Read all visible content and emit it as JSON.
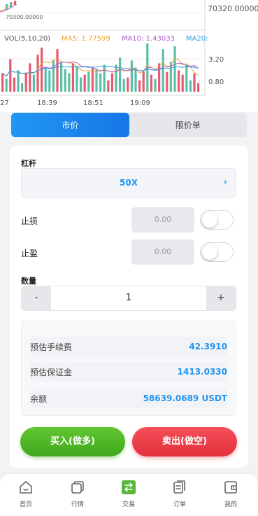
{
  "chart": {
    "price_top_right": "70320.00000",
    "price_left_label": "70300.00000",
    "vol_label": "VOL(5,10,20)",
    "ma5_label": "MA5: 1.77599",
    "ma10_label": "MA10: 1.43033",
    "ma20_label": "MA20:",
    "vol_tick_high": "3.20",
    "vol_tick_low": "0.80",
    "times": [
      "27",
      "18:39",
      "18:51",
      "19:09"
    ],
    "colors": {
      "up": "#5bbfa8",
      "down": "#e65c6e",
      "ma5": "#f0a030",
      "ma10": "#b45ac8",
      "ma20": "#2d9be0"
    },
    "volumes": [
      {
        "v": 1.3,
        "up": false
      },
      {
        "v": 0.9,
        "up": true
      },
      {
        "v": 2.3,
        "up": false
      },
      {
        "v": 1.0,
        "up": false
      },
      {
        "v": 1.5,
        "up": true
      },
      {
        "v": 0.6,
        "up": true
      },
      {
        "v": 1.3,
        "up": false
      },
      {
        "v": 2.0,
        "up": false
      },
      {
        "v": 1.2,
        "up": true
      },
      {
        "v": 2.6,
        "up": false
      },
      {
        "v": 3.1,
        "up": false
      },
      {
        "v": 1.7,
        "up": true
      },
      {
        "v": 1.5,
        "up": true
      },
      {
        "v": 2.2,
        "up": true
      },
      {
        "v": 3.0,
        "up": false
      },
      {
        "v": 2.1,
        "up": true
      },
      {
        "v": 1.6,
        "up": true
      },
      {
        "v": 1.3,
        "up": true
      },
      {
        "v": 2.0,
        "up": false
      },
      {
        "v": 1.8,
        "up": true
      },
      {
        "v": 1.0,
        "up": true
      },
      {
        "v": 1.2,
        "up": false
      },
      {
        "v": 1.4,
        "up": true
      },
      {
        "v": 1.7,
        "up": false
      },
      {
        "v": 1.6,
        "up": true
      },
      {
        "v": 1.3,
        "up": true
      },
      {
        "v": 1.9,
        "up": true
      },
      {
        "v": 0.8,
        "up": false
      },
      {
        "v": 1.3,
        "up": false
      },
      {
        "v": 1.9,
        "up": true
      },
      {
        "v": 2.4,
        "up": true
      },
      {
        "v": 0.9,
        "up": true
      },
      {
        "v": 1.0,
        "up": false
      },
      {
        "v": 2.2,
        "up": true
      },
      {
        "v": 1.7,
        "up": true
      },
      {
        "v": 0.8,
        "up": false
      },
      {
        "v": 1.4,
        "up": false
      },
      {
        "v": 3.4,
        "up": true
      },
      {
        "v": 1.2,
        "up": false
      },
      {
        "v": 0.9,
        "up": true
      },
      {
        "v": 2.0,
        "up": false
      },
      {
        "v": 3.0,
        "up": true
      },
      {
        "v": 1.4,
        "up": false
      },
      {
        "v": 2.1,
        "up": true
      },
      {
        "v": 3.2,
        "up": true
      },
      {
        "v": 1.5,
        "up": false
      },
      {
        "v": 1.2,
        "up": false
      },
      {
        "v": 1.9,
        "up": true
      },
      {
        "v": 0.8,
        "up": true
      },
      {
        "v": 1.3,
        "up": false
      },
      {
        "v": 0.6,
        "up": false
      }
    ]
  },
  "tabs": [
    {
      "label": "市价",
      "active": true
    },
    {
      "label": "限价单",
      "active": false
    }
  ],
  "form": {
    "leverage_label": "杠杆",
    "leverage_value": "50X",
    "stop_loss_label": "止损",
    "stop_loss_placeholder": "0.00",
    "take_profit_label": "止盈",
    "take_profit_placeholder": "0.00",
    "quantity_label": "数量",
    "quantity_value": "1",
    "minus": "-",
    "plus": "+"
  },
  "summary": [
    {
      "label": "预估手续费",
      "value": "42.3910"
    },
    {
      "label": "预估保证金",
      "value": "1413.0330"
    },
    {
      "label": "余额",
      "value": "58639.0689 USDT"
    }
  ],
  "actions": {
    "buy": "买入(做多)",
    "sell": "卖出(做空)"
  },
  "nav": [
    {
      "label": "首页",
      "icon": "home-icon",
      "active": false
    },
    {
      "label": "行情",
      "icon": "market-icon",
      "active": false
    },
    {
      "label": "交易",
      "icon": "trade-icon",
      "active": true
    },
    {
      "label": "订单",
      "icon": "order-icon",
      "active": false
    },
    {
      "label": "我的",
      "icon": "wallet-icon",
      "active": false
    }
  ]
}
